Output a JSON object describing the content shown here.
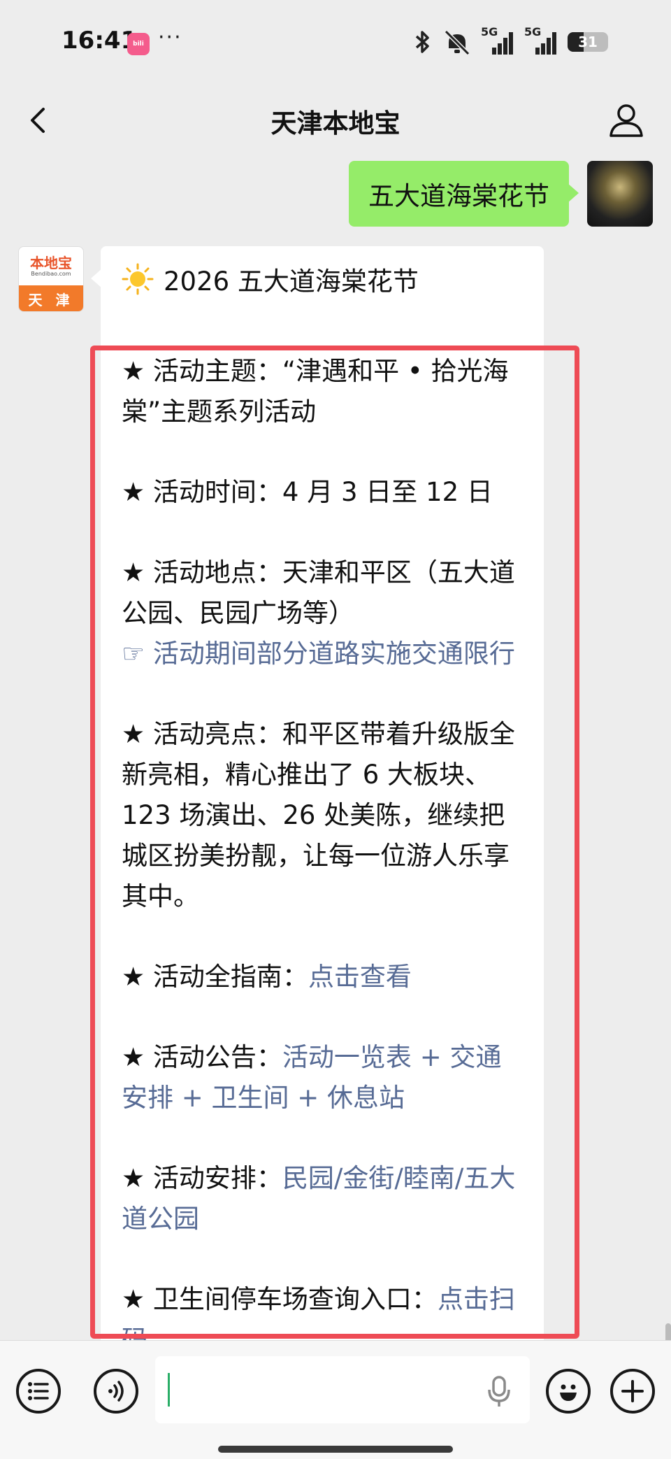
{
  "status_bar": {
    "time": "16:41",
    "app_badge": "bilibili",
    "more_dots": "···",
    "network_1": "5G",
    "network_2": "5G",
    "battery": "31"
  },
  "nav": {
    "title": "天津本地宝"
  },
  "chat": {
    "user_message": "五大道海棠花节",
    "bot_avatar": {
      "logo": "本地宝",
      "domain": "Bendibao.com",
      "city": "天 津"
    },
    "bot_message": {
      "heading": "2026 五大道海棠花节",
      "theme": "★ 活动主题：“津遇和平 • 拾光海棠”主题系列活动",
      "time": "★ 活动时间：4 月 3 日至 12 日",
      "location": "★ 活动地点：天津和平区（五大道公园、民园广场等）",
      "traffic_link": "☞ 活动期间部分道路实施交通限行",
      "highlights": "★ 活动亮点：和平区带着升级版全新亮相，精心推出了 6 大板块、123 场演出、26 处美陈，继续把城区扮美扮靓，让每一位游人乐享其中。",
      "guide_label": "★ 活动全指南：",
      "guide_link": "点击查看",
      "notice_label": "★ 活动公告：",
      "notice_link": "活动一览表 + 交通安排 + 卫生间 + 休息站",
      "arrangement_label": "★ 活动安排：",
      "arrangement_link": "民园/金街/睦南/五大道公园",
      "toilet_label": "★ 卫生间停车场查询入口：",
      "toilet_link": "点击扫码"
    }
  },
  "colors": {
    "user_bubble": "#95ec69",
    "link": "#576b95",
    "highlight_border": "#ee4b55",
    "background": "#ededed"
  },
  "icons": [
    "back-icon",
    "profile-icon",
    "sun-icon",
    "menu-list-icon",
    "voice-icon",
    "microphone-icon",
    "emoji-icon",
    "plus-icon"
  ]
}
